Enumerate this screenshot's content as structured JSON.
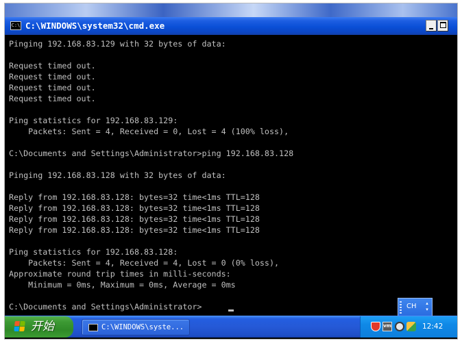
{
  "window": {
    "title": "C:\\WINDOWS\\system32\\cmd.exe",
    "icon_text": "C:\\"
  },
  "console": {
    "lines": [
      "Pinging 192.168.83.129 with 32 bytes of data:",
      "",
      "Request timed out.",
      "Request timed out.",
      "Request timed out.",
      "Request timed out.",
      "",
      "Ping statistics for 192.168.83.129:",
      "    Packets: Sent = 4, Received = 0, Lost = 4 (100% loss),",
      "",
      "C:\\Documents and Settings\\Administrator>ping 192.168.83.128",
      "",
      "Pinging 192.168.83.128 with 32 bytes of data:",
      "",
      "Reply from 192.168.83.128: bytes=32 time<1ms TTL=128",
      "Reply from 192.168.83.128: bytes=32 time<1ms TTL=128",
      "Reply from 192.168.83.128: bytes=32 time<1ms TTL=128",
      "Reply from 192.168.83.128: bytes=32 time<1ms TTL=128",
      "",
      "Ping statistics for 192.168.83.128:",
      "    Packets: Sent = 4, Received = 4, Lost = 0 (0% loss),",
      "Approximate round trip times in milli-seconds:",
      "    Minimum = 0ms, Maximum = 0ms, Average = 0ms",
      "",
      "C:\\Documents and Settings\\Administrator>"
    ]
  },
  "language_bar": {
    "label": "CH"
  },
  "taskbar": {
    "start_label": "开始",
    "task_button_label": "C:\\WINDOWS\\syste...",
    "clock": "12:42",
    "tray_icons": [
      "shield-icon",
      "vm-icon",
      "network-icon",
      "security-icon"
    ],
    "vm_icon_text": "vm"
  },
  "colors": {
    "console_bg": "#000000",
    "console_fg": "#c0c0c0",
    "titlebar": "#0a4fd6",
    "taskbar": "#2559d6",
    "start_button": "#3d9a34",
    "system_tray": "#0f88e6"
  }
}
